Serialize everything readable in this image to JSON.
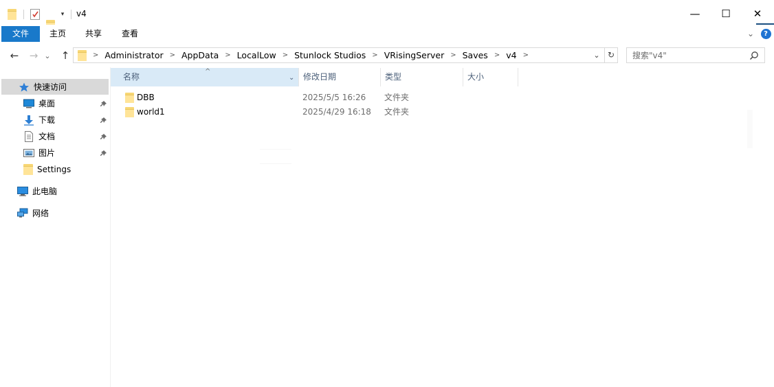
{
  "window": {
    "title": "v4",
    "minimize_glyph": "—",
    "maximize_glyph": "☐",
    "close_glyph": "✕"
  },
  "ribbon": {
    "tabs": [
      {
        "label": "文件",
        "active": true
      },
      {
        "label": "主页",
        "active": false
      },
      {
        "label": "共享",
        "active": false
      },
      {
        "label": "查看",
        "active": false
      }
    ],
    "expand_glyph": "⌄",
    "help_glyph": "?"
  },
  "nav": {
    "back_glyph": "←",
    "forward_glyph": "→",
    "recent_glyph": "⌄",
    "up_glyph": "↑",
    "breadcrumbs": [
      "Administrator",
      "AppData",
      "LocalLow",
      "Stunlock Studios",
      "VRisingServer",
      "Saves",
      "v4"
    ],
    "separator": ">",
    "address_dropdown_glyph": "⌄",
    "refresh_glyph": "↻"
  },
  "search": {
    "placeholder": "搜索\"v4\"",
    "icon": "search-icon"
  },
  "sidebar": {
    "quick_access": "快速访问",
    "items": [
      {
        "label": "桌面",
        "icon": "desktop-icon",
        "pinned": true
      },
      {
        "label": "下载",
        "icon": "download-icon",
        "pinned": true
      },
      {
        "label": "文档",
        "icon": "documents-icon",
        "pinned": true
      },
      {
        "label": "图片",
        "icon": "pictures-icon",
        "pinned": true
      },
      {
        "label": "Settings",
        "icon": "folder-icon",
        "pinned": false
      }
    ],
    "this_pc": "此电脑",
    "network": "网络",
    "pin_glyph": "📌"
  },
  "columns": {
    "name": "名称",
    "date": "修改日期",
    "type": "类型",
    "size": "大小",
    "sort_glyph": "^",
    "menu_glyph": "⌄"
  },
  "files": [
    {
      "name": "DBB",
      "date": "2025/5/5 16:26",
      "type": "文件夹"
    },
    {
      "name": "world1",
      "date": "2025/4/29 16:18",
      "type": "文件夹"
    }
  ],
  "colors": {
    "accent": "#1979ca",
    "folder": "#f8d775",
    "selected": "#d9d9d9",
    "sorted_header": "#d9eaf7"
  }
}
